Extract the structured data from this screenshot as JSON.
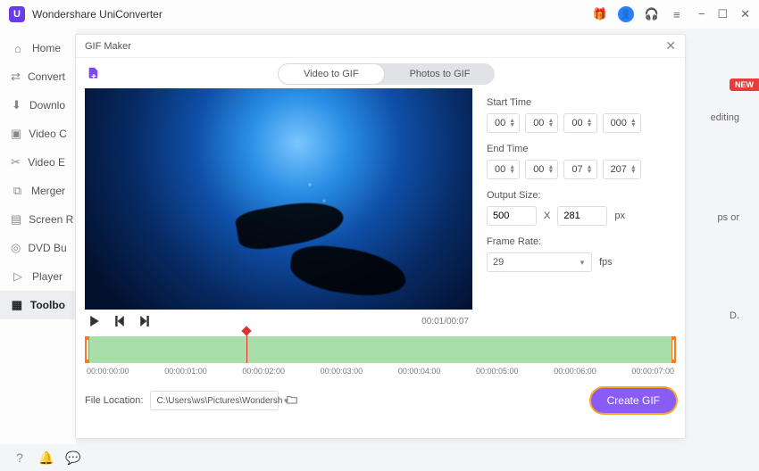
{
  "app": {
    "title": "Wondershare UniConverter"
  },
  "titlebar_icons": {
    "gift": "gift-icon",
    "user": "user-icon",
    "headset": "headset-icon",
    "menu": "menu-icon"
  },
  "window_controls": {
    "min": "−",
    "max": "☐",
    "close": "✕"
  },
  "sidebar": {
    "items": [
      {
        "icon": "home-icon",
        "glyph": "⌂",
        "label": "Home"
      },
      {
        "icon": "convert-icon",
        "glyph": "⇄",
        "label": "Convert"
      },
      {
        "icon": "download-icon",
        "glyph": "⬇",
        "label": "Downlo"
      },
      {
        "icon": "compress-icon",
        "glyph": "▣",
        "label": "Video C"
      },
      {
        "icon": "edit-icon",
        "glyph": "✂",
        "label": "Video E"
      },
      {
        "icon": "merge-icon",
        "glyph": "⧉",
        "label": "Merger"
      },
      {
        "icon": "record-icon",
        "glyph": "▤",
        "label": "Screen R"
      },
      {
        "icon": "dvd-icon",
        "glyph": "◎",
        "label": "DVD Bu"
      },
      {
        "icon": "player-icon",
        "glyph": "▷",
        "label": "Player"
      },
      {
        "icon": "toolbox-icon",
        "glyph": "▦",
        "label": "Toolbo",
        "active": true
      }
    ]
  },
  "bg": {
    "new_badge": "NEW",
    "t1": "editing",
    "t2": "ps or",
    "t3": "D."
  },
  "modal": {
    "title": "GIF Maker",
    "tabs": {
      "video": "Video to GIF",
      "photos": "Photos to GIF"
    },
    "timecode": "00:01/00:07",
    "settings": {
      "start_label": "Start Time",
      "start": {
        "h": "00",
        "m": "00",
        "s": "00",
        "ms": "000"
      },
      "end_label": "End Time",
      "end": {
        "h": "00",
        "m": "00",
        "s": "07",
        "ms": "207"
      },
      "size_label": "Output Size:",
      "size": {
        "w": "500",
        "x": "X",
        "h": "281",
        "unit": "px"
      },
      "fr_label": "Frame Rate:",
      "fr": {
        "val": "29",
        "unit": "fps"
      }
    },
    "ticks": [
      "00:00:00:00",
      "00:00:01:00",
      "00:00:02:00",
      "00:00:03:00",
      "00:00:04:00",
      "00:00:05:00",
      "00:00:06:00",
      "00:00:07:00"
    ],
    "footer": {
      "loc_label": "File Location:",
      "loc_value": "C:\\Users\\ws\\Pictures\\Wondersh",
      "create": "Create GIF"
    }
  },
  "statusbar": {
    "help": "?",
    "bell": "bell",
    "chat": "chat"
  }
}
